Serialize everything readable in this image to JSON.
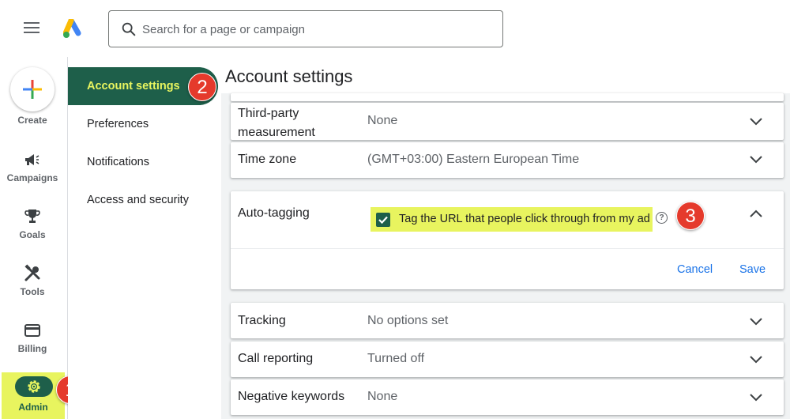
{
  "search": {
    "placeholder": "Search for a page or campaign"
  },
  "rail": {
    "create_label": "Create",
    "items": [
      {
        "label": "Campaigns",
        "icon": "megaphone-icon"
      },
      {
        "label": "Goals",
        "icon": "trophy-icon"
      },
      {
        "label": "Tools",
        "icon": "tools-icon"
      },
      {
        "label": "Billing",
        "icon": "credit-card-icon"
      },
      {
        "label": "Admin",
        "icon": "gear-icon"
      }
    ]
  },
  "subnav": {
    "items": [
      {
        "label": "Account settings",
        "active": true
      },
      {
        "label": "Preferences"
      },
      {
        "label": "Notifications"
      },
      {
        "label": "Access and security"
      }
    ]
  },
  "page": {
    "title": "Account settings"
  },
  "settings": [
    {
      "label": "Third-party measurement",
      "label_line1": "Third-party",
      "label_line2": "measurement",
      "value": "None"
    },
    {
      "label": "Time zone",
      "value": "(GMT+03:00) Eastern European Time"
    },
    {
      "label": "Auto-tagging",
      "checkbox_label": "Tag the URL that people click through from my ad",
      "checked": true,
      "cancel_label": "Cancel",
      "save_label": "Save"
    },
    {
      "label": "Tracking",
      "value": "No options set"
    },
    {
      "label": "Call reporting",
      "value": "Turned off"
    },
    {
      "label": "Negative keywords",
      "value": "None"
    }
  ],
  "annotations": {
    "step1": "1",
    "step2": "2",
    "step3": "3"
  },
  "colors": {
    "accent_green": "#1e5f4a",
    "highlight_yellow": "#e8f45f",
    "badge_red": "#e53a2c",
    "link_blue": "#1a73e8"
  }
}
